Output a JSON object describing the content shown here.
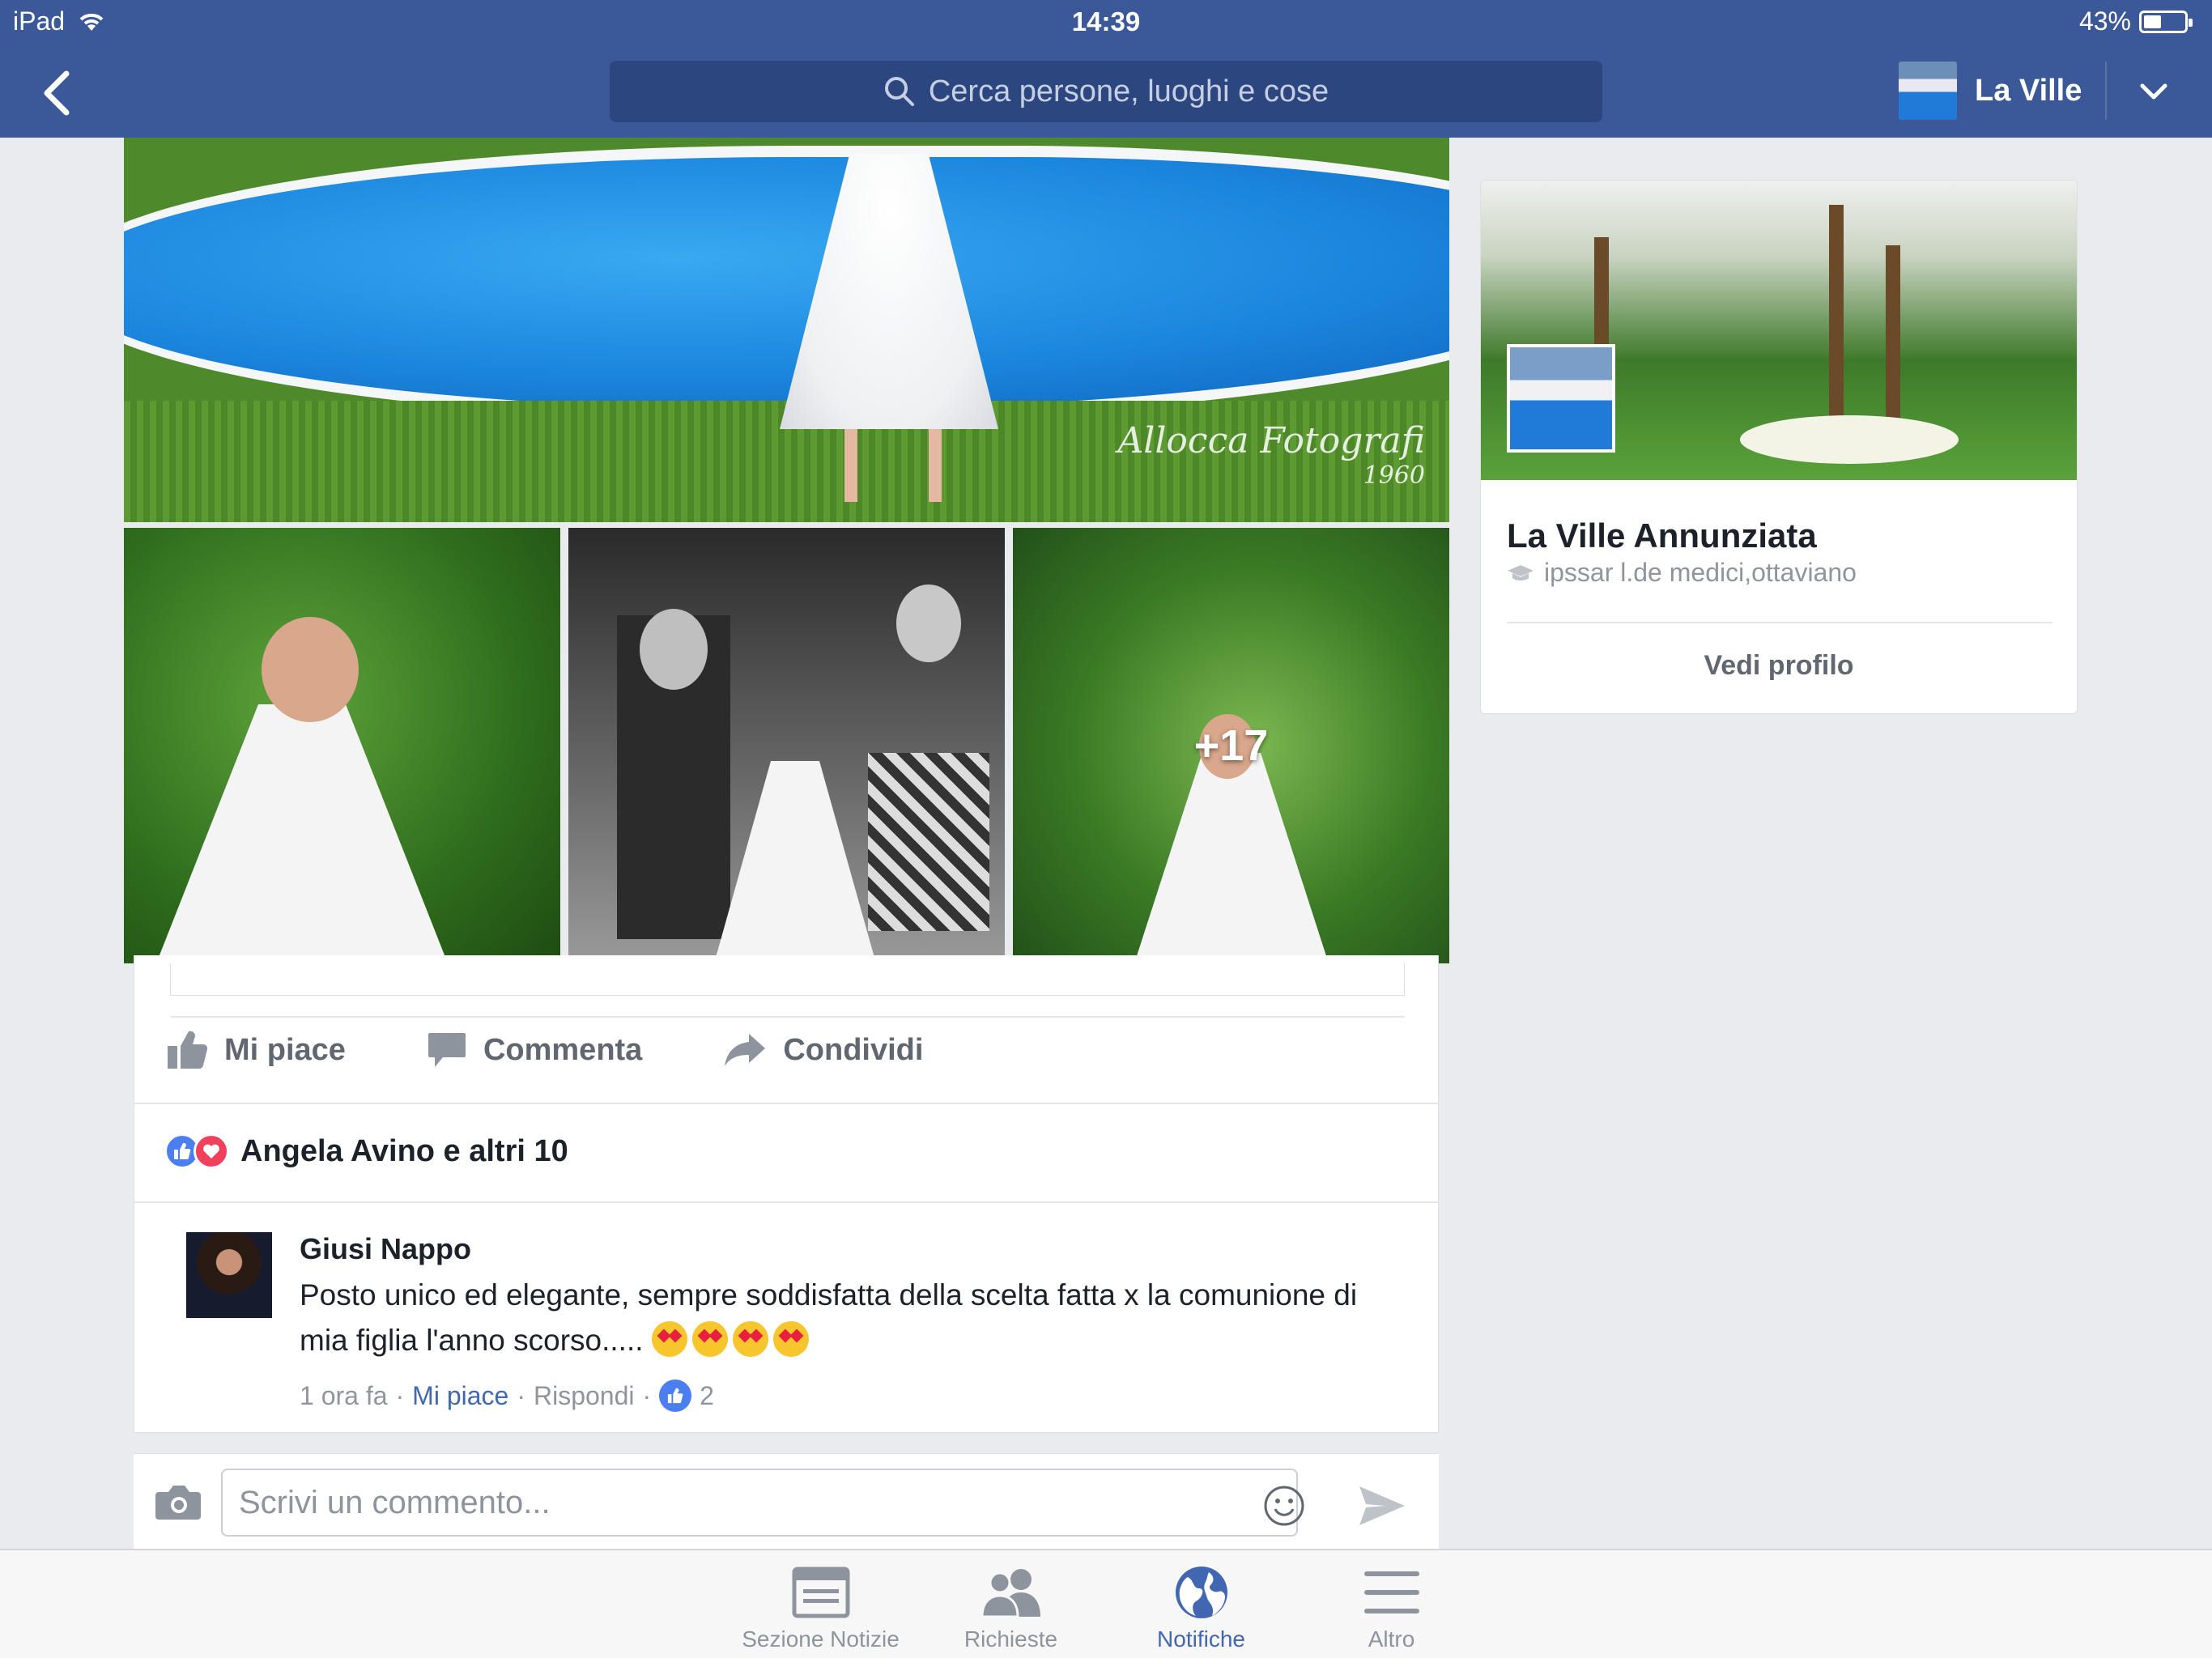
{
  "status_bar": {
    "device": "iPad",
    "time": "14:39",
    "battery": "43%",
    "battery_level": 0.43
  },
  "nav": {
    "search_placeholder": "Cerca persone, luoghi e cose",
    "profile_name": "La Ville"
  },
  "post": {
    "photo_watermark": "Allocca Fotografi",
    "photo_watermark_year": "1960",
    "more_photos": "+17",
    "actions": {
      "like": "Mi piace",
      "comment": "Commenta",
      "share": "Condividi"
    },
    "reactions_text": "Angela Avino e altri 10",
    "comment": {
      "author": "Giusi Nappo",
      "text": "Posto unico ed elegante, sempre soddisfatta della scelta fatta x la comunione di mia figlia l'anno scorso.....",
      "time": "1 ora fa",
      "like_link": "Mi piace",
      "reply_link": "Rispondi",
      "like_count": "2"
    }
  },
  "composer": {
    "placeholder": "Scrivi un commento..."
  },
  "profile_card": {
    "name": "La Ville Annunziata",
    "school": "ipssar l.de medici,ottaviano",
    "button": "Vedi profilo"
  },
  "tabs": [
    {
      "label": "Sezione Notizie",
      "icon": "news-feed-icon",
      "active": false
    },
    {
      "label": "Richieste",
      "icon": "friend-requests-icon",
      "active": false
    },
    {
      "label": "Notifiche",
      "icon": "globe-icon",
      "active": true
    },
    {
      "label": "Altro",
      "icon": "menu-icon",
      "active": false
    }
  ],
  "colors": {
    "brand": "#3b5998",
    "link": "#4267b2",
    "like": "#4b7ef0",
    "love": "#f0405c"
  }
}
